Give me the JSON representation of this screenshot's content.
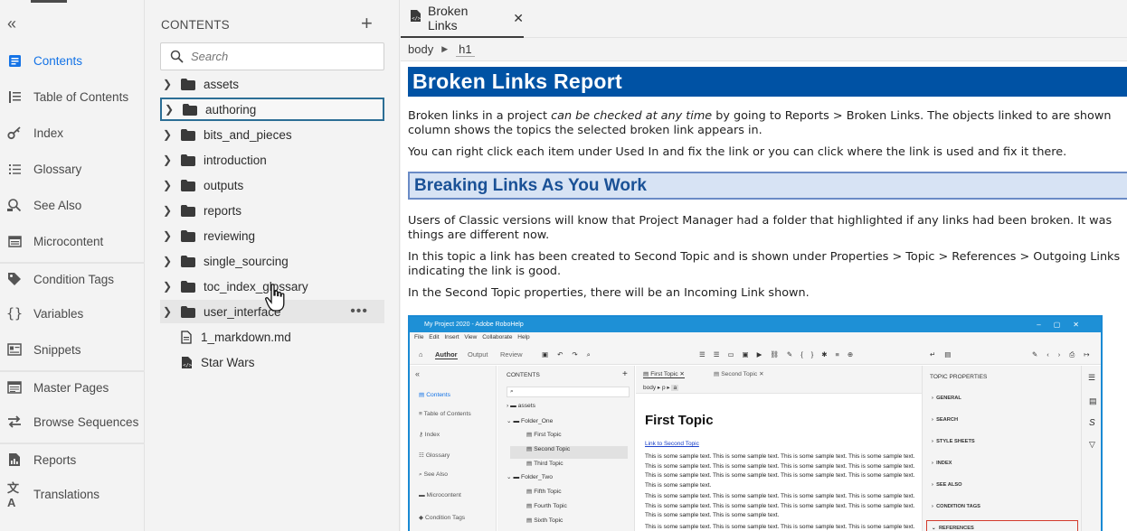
{
  "nav": {
    "items": [
      {
        "label": "Contents",
        "icon": "contents-icon",
        "active": true
      },
      {
        "label": "Table of Contents",
        "icon": "toc-icon"
      },
      {
        "label": "Index",
        "icon": "key-icon"
      },
      {
        "label": "Glossary",
        "icon": "glossary-icon"
      },
      {
        "label": "See Also",
        "icon": "see-also-icon"
      },
      {
        "label": "Microcontent",
        "icon": "microcontent-icon"
      },
      {
        "label": "Condition Tags",
        "icon": "tag-icon"
      },
      {
        "label": "Variables",
        "icon": "braces-icon"
      },
      {
        "label": "Snippets",
        "icon": "snippet-icon"
      },
      {
        "label": "Master Pages",
        "icon": "master-page-icon"
      },
      {
        "label": "Browse Sequences",
        "icon": "browse-sequence-icon"
      },
      {
        "label": "Reports",
        "icon": "report-icon"
      },
      {
        "label": "Translations",
        "icon": "translate-icon"
      }
    ],
    "accent": "#1473e6"
  },
  "tree": {
    "title": "CONTENTS",
    "search_placeholder": "Search",
    "folders": [
      "assets",
      "authoring",
      "bits_and_pieces",
      "introduction",
      "outputs",
      "reports",
      "reviewing",
      "single_sourcing",
      "toc_index_glossary",
      "user_interface"
    ],
    "files": [
      "1_markdown.md",
      "Star Wars"
    ],
    "focused": "authoring",
    "hovered": "user_interface",
    "more_label": "•••"
  },
  "editor": {
    "tab_label": "Broken Links",
    "breadcrumb": [
      "body",
      "h1"
    ],
    "heading1": "Broken Links Report",
    "para1_a": "Broken links in a project ",
    "para1_em": "can be checked at any time",
    "para1_b": " by going to Reports > Broken Links. The objects linked to are shown",
    "para1_line2": "column shows the topics the selected broken link appears in.",
    "para2": "You can right click each item under Used In and fix the link or you can click where the link is used and fix it there.",
    "heading2": "Breaking Links As You Work",
    "para3_line1": "Users of Classic versions will know that Project Manager had a folder that highlighted if any links had been broken. It was",
    "para3_line2": "things are different now.",
    "para4_line1": "In this topic a link has been created to Second Topic and is shown under Properties > Topic > References > Outgoing Links",
    "para4_line2": "indicating the link is good.",
    "para5": "In the Second Topic properties, there will be an Incoming Link shown.",
    "heading1_color": "#0052a4",
    "heading2_color": "#1a5196"
  },
  "screenshot": {
    "title": "My Project 2020 - Adobe RoboHelp",
    "menu": [
      "File",
      "Edit",
      "Insert",
      "View",
      "Collaborate",
      "Help"
    ],
    "modes": [
      "Author",
      "Output",
      "Review"
    ],
    "nav": [
      "Contents",
      "Table of Contents",
      "Index",
      "Glossary",
      "See Also",
      "Microcontent",
      "Condition Tags"
    ],
    "tree_title": "CONTENTS",
    "tree": [
      "assets",
      "Folder_One",
      "First Topic",
      "Second Topic",
      "Third Topic",
      "Folder_Two",
      "Fifth Topic",
      "Fourth Topic",
      "Sixth Topic"
    ],
    "tabs": [
      "First Topic",
      "Second Topic"
    ],
    "crumb": [
      "body",
      "p",
      "a"
    ],
    "topic_title": "First Topic",
    "link_text": "Link to Second Topic",
    "para_a": "This is some sample text. This is some sample text. This is some sample text. This is some sample text. This is some sample text. This is some sample text. This is some sample text. This is some sample text. This is some sample text. This is some sample text. This is some sample text. This is some sample text. This is some sample text.",
    "para_b": "This is some sample text. This is some sample text. This is some sample text. This is some sample text. This is some sample text. This is some sample text. This is some sample text. This is some sample text. This is some sample text. This is some sample text.",
    "para_c": "This is some sample text. This is some sample text. This is some sample text. This is some sample text.",
    "props_title": "TOPIC PROPERTIES",
    "props": [
      "GENERAL",
      "SEARCH",
      "STYLE SHEETS",
      "INDEX",
      "SEE ALSO",
      "CONDITION TAGS",
      "REFERENCES"
    ]
  }
}
